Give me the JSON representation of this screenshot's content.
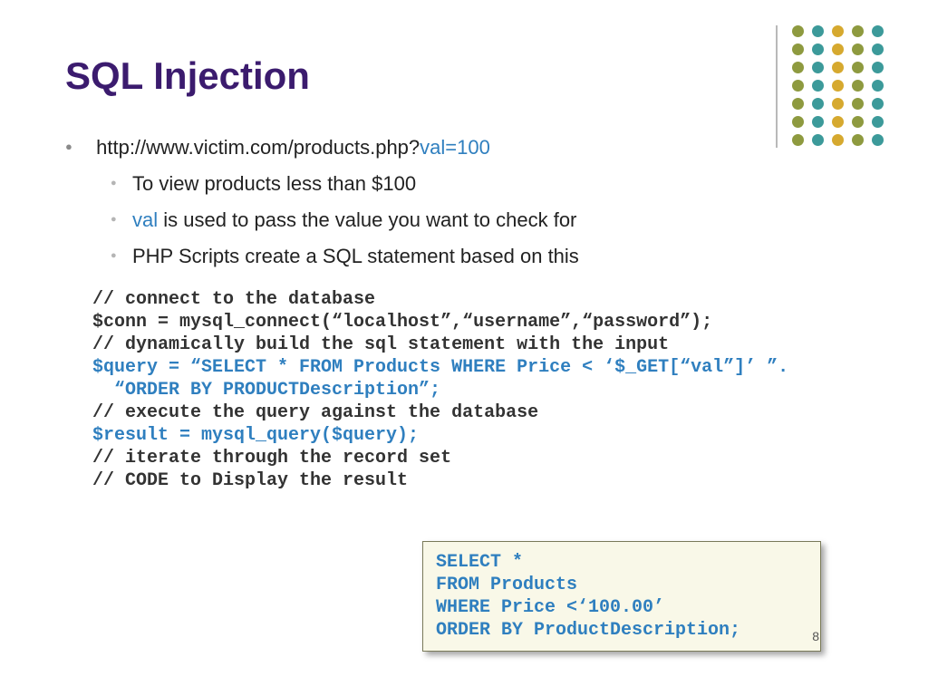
{
  "title": "SQL Injection",
  "bullet1_prefix": "http://www.victim.com/products.php?",
  "bullet1_param": "val=100",
  "sub1": "To view products less than $100",
  "sub2_hl": "val",
  "sub2_rest": " is used to pass the value you want to check for",
  "sub3": "PHP Scripts create a SQL statement based on this",
  "code": {
    "l1": "// connect to the database",
    "l2": "$conn = mysql_connect(“localhost”,“username”,“password”);",
    "l3": "// dynamically build the sql statement with the input",
    "l4": "$query = “SELECT * FROM Products WHERE Price < ‘$_GET[“val”]’ ”.",
    "l5": "  “ORDER BY PRODUCTDescription”;",
    "l6": "// execute the query against the database",
    "l7": "$result = mysql_query($query);",
    "l8": "// iterate through the record set",
    "l9": "// CODE to Display the result"
  },
  "sql": {
    "l1": "SELECT *",
    "l2": "FROM Products",
    "l3": "WHERE Price <‘100.00’",
    "l4": "ORDER BY ProductDescription;"
  },
  "page_number": "8"
}
